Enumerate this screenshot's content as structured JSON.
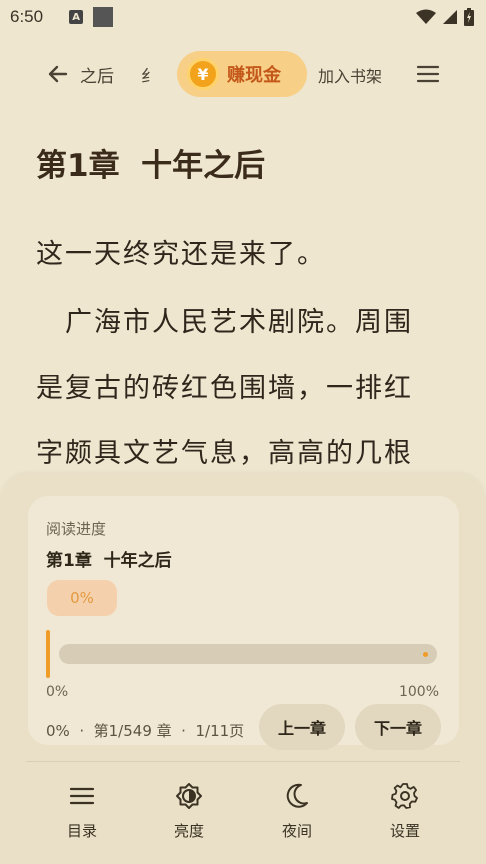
{
  "status_bar": {
    "time": "6:50",
    "a_badge": "A"
  },
  "top_bar": {
    "chapter_scroll": "之后     纟",
    "earn_coin_symbol": "¥",
    "earn_label": "赚现金",
    "add_shelf": "加入书架"
  },
  "content": {
    "chapter_title": "第1章  十年之后",
    "lines": [
      "这一天终究还是来了。",
      "　广海市人民艺术剧院。周围",
      "是复古的砖红色围墙，一排红",
      "字颇具文艺气息，高高的几根"
    ]
  },
  "progress": {
    "label": "阅读进度",
    "chapter": "第1章  十年之后",
    "percent_badge": "0%",
    "value": 0,
    "min_label": "0%",
    "max_label": "100%",
    "summary": "0%  ·  第1/549 章  ·  1/11页",
    "prev_label": "上一章",
    "next_label": "下一章"
  },
  "bottom_nav": [
    {
      "label": "目录",
      "icon": "list-icon"
    },
    {
      "label": "亮度",
      "icon": "brightness-icon"
    },
    {
      "label": "夜间",
      "icon": "moon-icon"
    },
    {
      "label": "设置",
      "icon": "gear-icon"
    }
  ],
  "colors": {
    "accent": "#f09c28",
    "earn_bg": "#f8cf86",
    "earn_text": "#c3581a",
    "page_bg": "#efe6cf"
  }
}
